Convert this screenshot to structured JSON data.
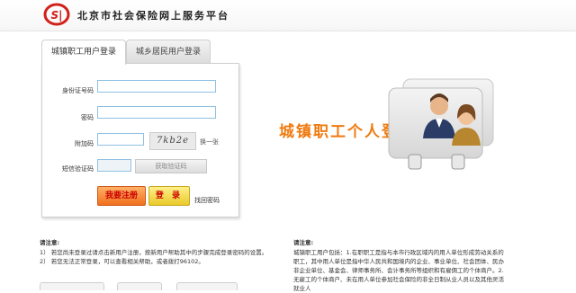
{
  "header": {
    "site_title": "北京市社会保险网上服务平台",
    "logo_text": "SI"
  },
  "tabs": [
    {
      "label": "城镇职工用户登录",
      "active": true
    },
    {
      "label": "城乡居民用户登录",
      "active": false
    }
  ],
  "form": {
    "id_label": "身份证号码",
    "password_label": "密码",
    "captcha_label": "附加码",
    "captcha_image_text": "7kb2e",
    "refresh_label": "换一张",
    "sms_label": "短信验证码",
    "sms_button": "获取验证码",
    "register_button": "我要注册",
    "login_button": "登 录",
    "forgot_link": "找回密码"
  },
  "promo": {
    "title": "城镇职工个人登录"
  },
  "notice_left": {
    "title": "请注意:",
    "lines": [
      "1） 若您尚未登录过请点击新用户注册，按新用户帮助其中的步骤完成登录密码的设置。",
      "2） 若您无法正常登录，可以查看相关帮助，或者拨打96102。"
    ]
  },
  "notice_right": {
    "title": "请注意:",
    "lines": [
      "城镇职工用户包括：1.在职职工是指与本市行政区域内的用人单位形成劳动关系的职工，其中用人单位是指中华人民共和国境内的企业、事业单位、社会团体、民办非企业单位、基金会、律师事务所、会计事务所等组织和有雇佣工的个体商户。2.无雇工的个体商户、未在用人单位参加社会保险的非全日制从业人员以及其他灵活就业人"
    ]
  },
  "colors": {
    "accent_orange": "#f07a10",
    "input_border": "#8fc1e3",
    "button_text": "#cc0000"
  }
}
